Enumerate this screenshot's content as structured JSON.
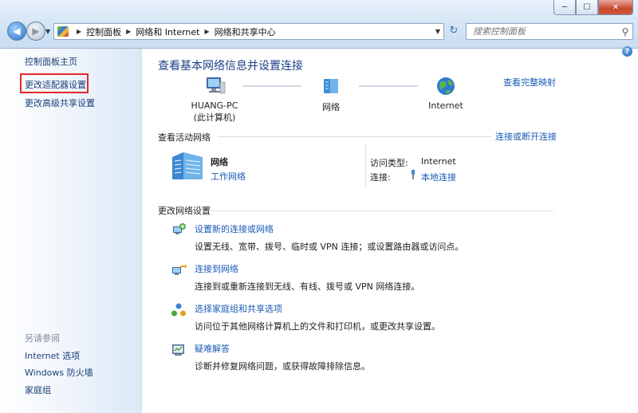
{
  "window": {
    "minimize": "─",
    "maximize": "☐",
    "close": "✕"
  },
  "address_bar": {
    "crumbs": [
      "控制面板",
      "网络和 Internet",
      "网络和共享中心"
    ]
  },
  "search": {
    "placeholder": "搜索控制面板"
  },
  "sidebar": {
    "items": [
      "控制面板主页",
      "更改适配器设置",
      "更改高级共享设置"
    ],
    "see_also_title": "另请参阅",
    "see_also": [
      "Internet 选项",
      "Windows 防火墙",
      "家庭组"
    ]
  },
  "main": {
    "title": "查看基本网络信息并设置连接",
    "full_map_link": "查看完整映射",
    "map_nodes": [
      {
        "name": "HUANG-PC",
        "sub": "(此计算机)",
        "icon": "computer-icon"
      },
      {
        "name": "网络",
        "sub": "",
        "icon": "network-icon"
      },
      {
        "name": "Internet",
        "sub": "",
        "icon": "globe-icon"
      }
    ],
    "active_networks_header": "查看活动网络",
    "connect_disconnect_link": "连接或断开连接",
    "network": {
      "name": "网络",
      "type": "工作网络"
    },
    "access_type_label": "访问类型:",
    "access_type_value": "Internet",
    "connection_label": "连接:",
    "connection_value": "本地连接",
    "change_settings_header": "更改网络设置",
    "tasks": [
      {
        "link": "设置新的连接或网络",
        "desc": "设置无线、宽带、拨号、临时或 VPN 连接；或设置路由器或访问点。",
        "icon": "new-connection-icon"
      },
      {
        "link": "连接到网络",
        "desc": "连接到或重新连接到无线、有线、拨号或 VPN 网络连接。",
        "icon": "connect-network-icon"
      },
      {
        "link": "选择家庭组和共享选项",
        "desc": "访问位于其他网络计算机上的文件和打印机，或更改共享设置。",
        "icon": "homegroup-icon"
      },
      {
        "link": "疑难解答",
        "desc": "诊断并修复网络问题，或获得故障排除信息。",
        "icon": "troubleshoot-icon"
      }
    ]
  }
}
